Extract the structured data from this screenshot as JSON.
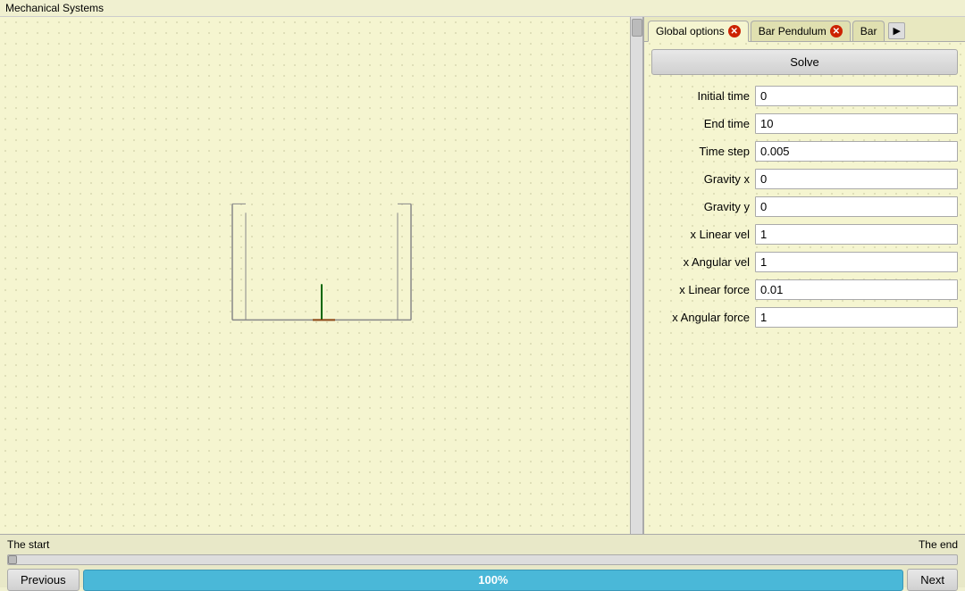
{
  "app": {
    "title": "Mechanical Systems"
  },
  "tabs": [
    {
      "id": "global-options",
      "label": "Global options",
      "active": true,
      "closeable": true
    },
    {
      "id": "bar-pendulum",
      "label": "Bar Pendulum",
      "active": false,
      "closeable": true
    },
    {
      "id": "bar",
      "label": "Bar",
      "active": false,
      "closeable": false
    }
  ],
  "tab_scroll_label": "▶",
  "panel": {
    "solve_label": "Solve",
    "fields": [
      {
        "label": "Initial time",
        "value": "0"
      },
      {
        "label": "End time",
        "value": "10"
      },
      {
        "label": "Time step",
        "value": "0.005"
      },
      {
        "label": "Gravity x",
        "value": "0"
      },
      {
        "label": "Gravity y",
        "value": "0"
      },
      {
        "label": "x Linear vel",
        "value": "1"
      },
      {
        "label": "x Angular vel",
        "value": "1"
      },
      {
        "label": "x Linear force",
        "value": "0.01"
      },
      {
        "label": "x Angular force",
        "value": "1"
      }
    ]
  },
  "bottom": {
    "start_label": "The start",
    "end_label": "The end",
    "prev_label": "Previous",
    "next_label": "Next",
    "progress_value": "100%"
  }
}
